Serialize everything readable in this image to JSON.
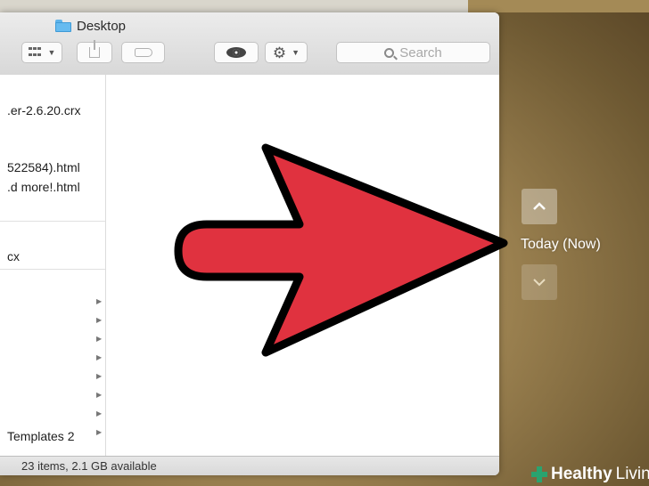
{
  "window": {
    "title": "Desktop",
    "status": "23 items, 2.1 GB available"
  },
  "toolbar": {
    "view_icon": "grid-view-icon",
    "share_icon": "share-icon",
    "tag_icon": "tag-icon",
    "quicklook_icon": "eye-icon",
    "action_icon": "gear-icon",
    "search_placeholder": "Search"
  },
  "files": [
    ".er-2.6.20.crx",
    "522584).html",
    ".d more!.html",
    "cx",
    "Templates 2"
  ],
  "time_machine": {
    "label": "Today (Now)",
    "up_icon": "chevron-up-icon",
    "down_icon": "chevron-down-icon"
  },
  "overlay": {
    "arrow_color": "#e0323f",
    "arrow_icon": "red-pointer-arrow"
  },
  "watermark": {
    "part1": "Healthy",
    "part2": "Living"
  }
}
